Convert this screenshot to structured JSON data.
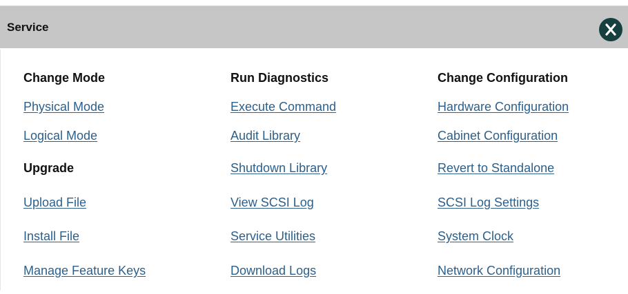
{
  "dialog": {
    "title": "Service",
    "close_icon": "close-x-icon",
    "colors": {
      "header_bg": "#c6c6c6",
      "link": "#2c5f8a",
      "close_bg": "#15403f"
    }
  },
  "columns": {
    "change_mode": {
      "heading": "Change Mode",
      "links": [
        "Physical Mode",
        "Logical Mode"
      ],
      "upgrade_heading": "Upgrade",
      "upgrade_links": [
        "Upload File",
        "Install File",
        "Manage Feature Keys"
      ]
    },
    "run_diagnostics": {
      "heading": "Run Diagnostics",
      "links": [
        "Execute Command",
        "Audit Library",
        "Shutdown Library",
        "View SCSI Log",
        "Service Utilities",
        "Download Logs"
      ]
    },
    "change_configuration": {
      "heading": "Change Configuration",
      "links": [
        "Hardware Configuration",
        "Cabinet Configuration",
        "Revert to Standalone",
        "SCSI Log Settings",
        "System Clock",
        "Network Configuration"
      ]
    }
  }
}
